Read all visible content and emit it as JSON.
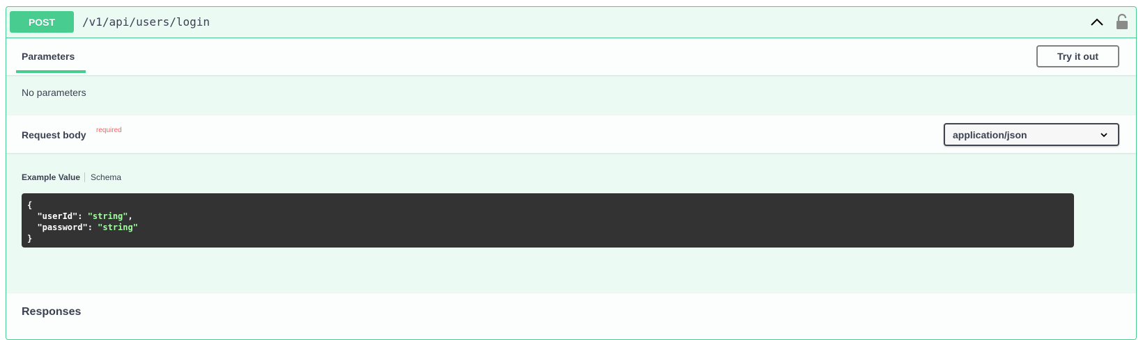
{
  "operation": {
    "method": "POST",
    "path": "/v1/api/users/login"
  },
  "parameters": {
    "title": "Parameters",
    "try_button": "Try it out",
    "empty_text": "No parameters"
  },
  "request_body": {
    "title": "Request body",
    "required_label": "required",
    "content_type": "application/json"
  },
  "model_tabs": {
    "example": "Example Value",
    "schema": "Schema"
  },
  "example": {
    "open_brace": "{",
    "close_brace": "}",
    "fields": [
      {
        "key": "\"userId\"",
        "value": "\"string\"",
        "trail": ","
      },
      {
        "key": "\"password\"",
        "value": "\"string\"",
        "trail": ""
      }
    ]
  },
  "responses": {
    "title": "Responses"
  },
  "colors": {
    "post_accent": "#49cc90",
    "code_bg": "#333333",
    "string_color": "#a2fca2",
    "required_color": "#ff6060"
  },
  "icons": {
    "collapse": "chevron-up-icon",
    "auth": "unlocked-icon",
    "select": "chevron-down-icon"
  }
}
